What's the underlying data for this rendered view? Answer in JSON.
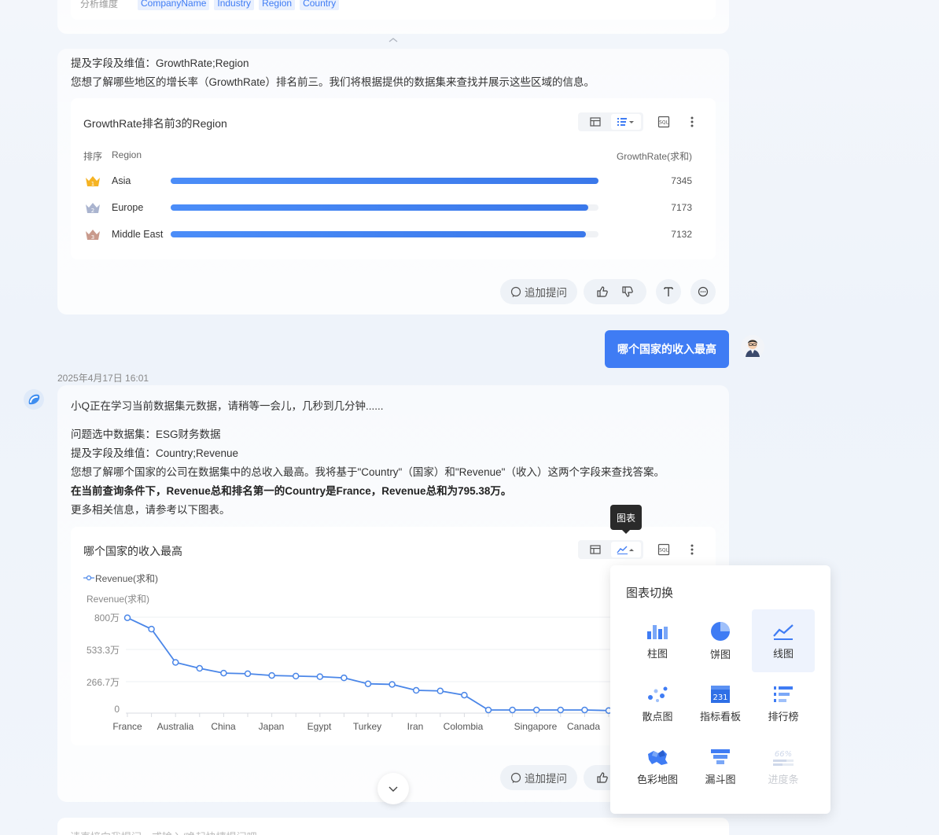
{
  "top_card": {
    "dim_label": "分析维度",
    "dims": [
      "CompanyName",
      "Industry",
      "Region",
      "Country"
    ]
  },
  "msg1": {
    "fields_line": "提及字段及维值：GrowthRate;Region",
    "intent_line": "您想了解哪些地区的增长率（GrowthRate）排名前三。我们将根据提供的数据集来查找并展示这些区域的信息。",
    "chart_title": "GrowthRate排名前3的Region",
    "col_rank": "排序",
    "col_region": "Region",
    "col_value": "GrowthRate(求和)",
    "rows": [
      {
        "rank": "1",
        "label": "Asia",
        "value": "7345",
        "pct": 1.0
      },
      {
        "rank": "2",
        "label": "Europe",
        "value": "7173",
        "pct": 0.977
      },
      {
        "rank": "3",
        "label": "Middle East",
        "value": "7132",
        "pct": 0.971
      }
    ],
    "followup_label": "追加提问"
  },
  "user_question": "哪个国家的收入最高",
  "timestamp": "2025年4月17日 16:01",
  "msg2": {
    "loading_line": "小Q正在学习当前数据集元数据，请稍等一会儿，几秒到几分钟......",
    "dataset_line": "问题选中数据集：ESG财务数据",
    "fields_line": "提及字段及维值：Country;Revenue",
    "intent_line": "您想了解哪个国家的公司在数据集中的总收入最高。我将基于\"Country\"（国家）和\"Revenue\"（收入）这两个字段来查找答案。",
    "answer_line": "在当前查询条件下，Revenue总和排名第一的Country是France，Revenue总和为795.38万。",
    "more_line": "更多相关信息，请参考以下图表。",
    "chart_title": "哪个国家的收入最高",
    "tooltip": "图表",
    "legend": "Revenue(求和)",
    "followup_label": "追加提问"
  },
  "chart_data": {
    "type": "line",
    "title": "哪个国家的收入最高",
    "ylabel": "Revenue(求和)",
    "legend": [
      "Revenue(求和)"
    ],
    "yticks": [
      "800万",
      "533.3万",
      "266.7万",
      "0"
    ],
    "ylim": [
      0,
      800
    ],
    "x_tick_labels": [
      "France",
      "Australia",
      "China",
      "Japan",
      "Egypt",
      "Turkey",
      "Iran",
      "Colombia",
      "Singapore",
      "Canada"
    ],
    "series": [
      {
        "name": "Revenue(求和)",
        "values": [
          795.38,
          700,
          420,
          370,
          330,
          325,
          310,
          305,
          300,
          290,
          240,
          235,
          185,
          180,
          145,
          20,
          20,
          20,
          20,
          20,
          15
        ]
      }
    ]
  },
  "popover": {
    "title": "图表切换",
    "items": [
      {
        "label": "柱图",
        "icon": "bar-chart-icon"
      },
      {
        "label": "饼图",
        "icon": "pie-chart-icon"
      },
      {
        "label": "线图",
        "icon": "line-chart-icon",
        "selected": true
      },
      {
        "label": "散点图",
        "icon": "scatter-chart-icon"
      },
      {
        "label": "指标看板",
        "icon": "metric-board-icon",
        "badge": "231"
      },
      {
        "label": "排行榜",
        "icon": "ranking-icon"
      },
      {
        "label": "色彩地图",
        "icon": "color-map-icon"
      },
      {
        "label": "漏斗图",
        "icon": "funnel-chart-icon"
      },
      {
        "label": "进度条",
        "icon": "progress-icon",
        "badge": "66%",
        "disabled": true
      }
    ]
  },
  "input_placeholder": "请直接向我提问，或输入/唤起快捷提问吧",
  "colors": {
    "accent": "#3f7cf4",
    "line": "#4a86e8"
  }
}
